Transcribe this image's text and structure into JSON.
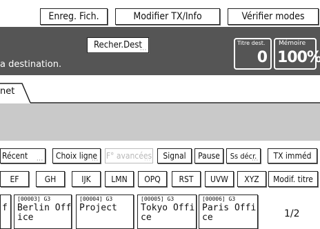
{
  "toolbar": {
    "save_file": "Enreg. Fich.",
    "modify_tx": "Modifier TX/Info",
    "check_modes": "Vérifier modes"
  },
  "header": {
    "search_dest": "Recher.Dest",
    "message": "a destination.",
    "dest_title_label": "Titre dest.",
    "dest_title_value": "0",
    "memory_label": "Mémoire",
    "memory_value": "100%"
  },
  "tabs": {
    "partial_tab": "net"
  },
  "row1": {
    "recent": "Récent",
    "choose_line": "Choix ligne",
    "advanced": "F° avancées",
    "signal": "Signal",
    "pause": "Pause",
    "sub_code": "Ss décr.",
    "tx_immediate": "TX imméd"
  },
  "row2": {
    "ef": "EF",
    "gh": "GH",
    "ijk": "IJK",
    "lmn": "LMN",
    "opq": "OPQ",
    "rst": "RST",
    "uvw": "UVW",
    "xyz": "XYZ",
    "modify_title": "Modif. titre"
  },
  "destinations": [
    {
      "code": "",
      "name": "f"
    },
    {
      "code": "[00003] G3",
      "name": "Berlin Off\nice"
    },
    {
      "code": "[00004] G3",
      "name": "Project"
    },
    {
      "code": "[00005] G3",
      "name": "Tokyo Offi\nce"
    },
    {
      "code": "[00006] G3",
      "name": "Paris Offi\nce"
    }
  ],
  "pager": {
    "page": "1/2"
  }
}
